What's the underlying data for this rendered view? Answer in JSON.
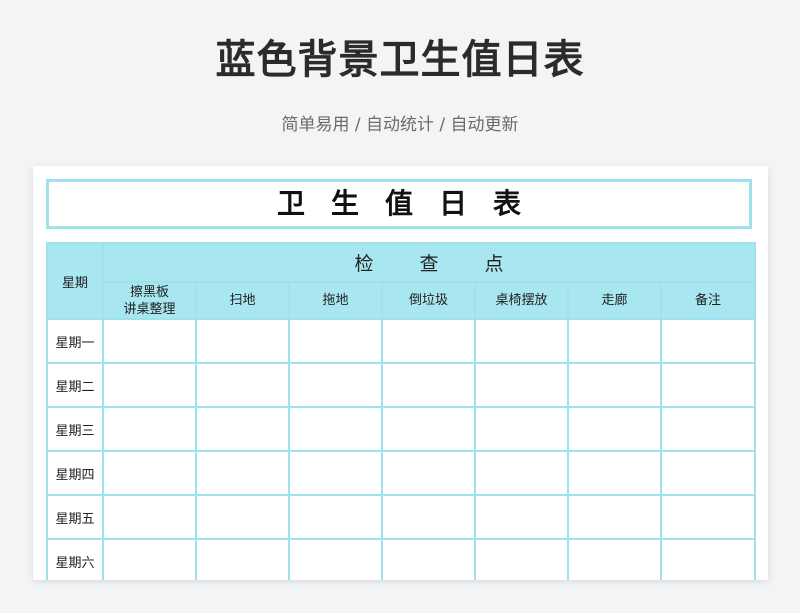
{
  "page": {
    "title": "蓝色背景卫生值日表",
    "subtitle": "简单易用 / 自动统计 / 自动更新"
  },
  "sheet": {
    "title": "卫生值日表",
    "day_header": "星期",
    "check_header": "检查点",
    "columns": [
      "擦黑板\n讲桌整理",
      "扫地",
      "拖地",
      "倒垃圾",
      "桌椅摆放",
      "走廊",
      "备注"
    ],
    "rows": [
      {
        "day": "星期一"
      },
      {
        "day": "星期二"
      },
      {
        "day": "星期三"
      },
      {
        "day": "星期四"
      },
      {
        "day": "星期五"
      },
      {
        "day": "星期六"
      }
    ]
  },
  "colors": {
    "header_fill": "#a8e6f0",
    "grid_border": "#9fe2ee",
    "page_background": "#f3f4f6"
  }
}
